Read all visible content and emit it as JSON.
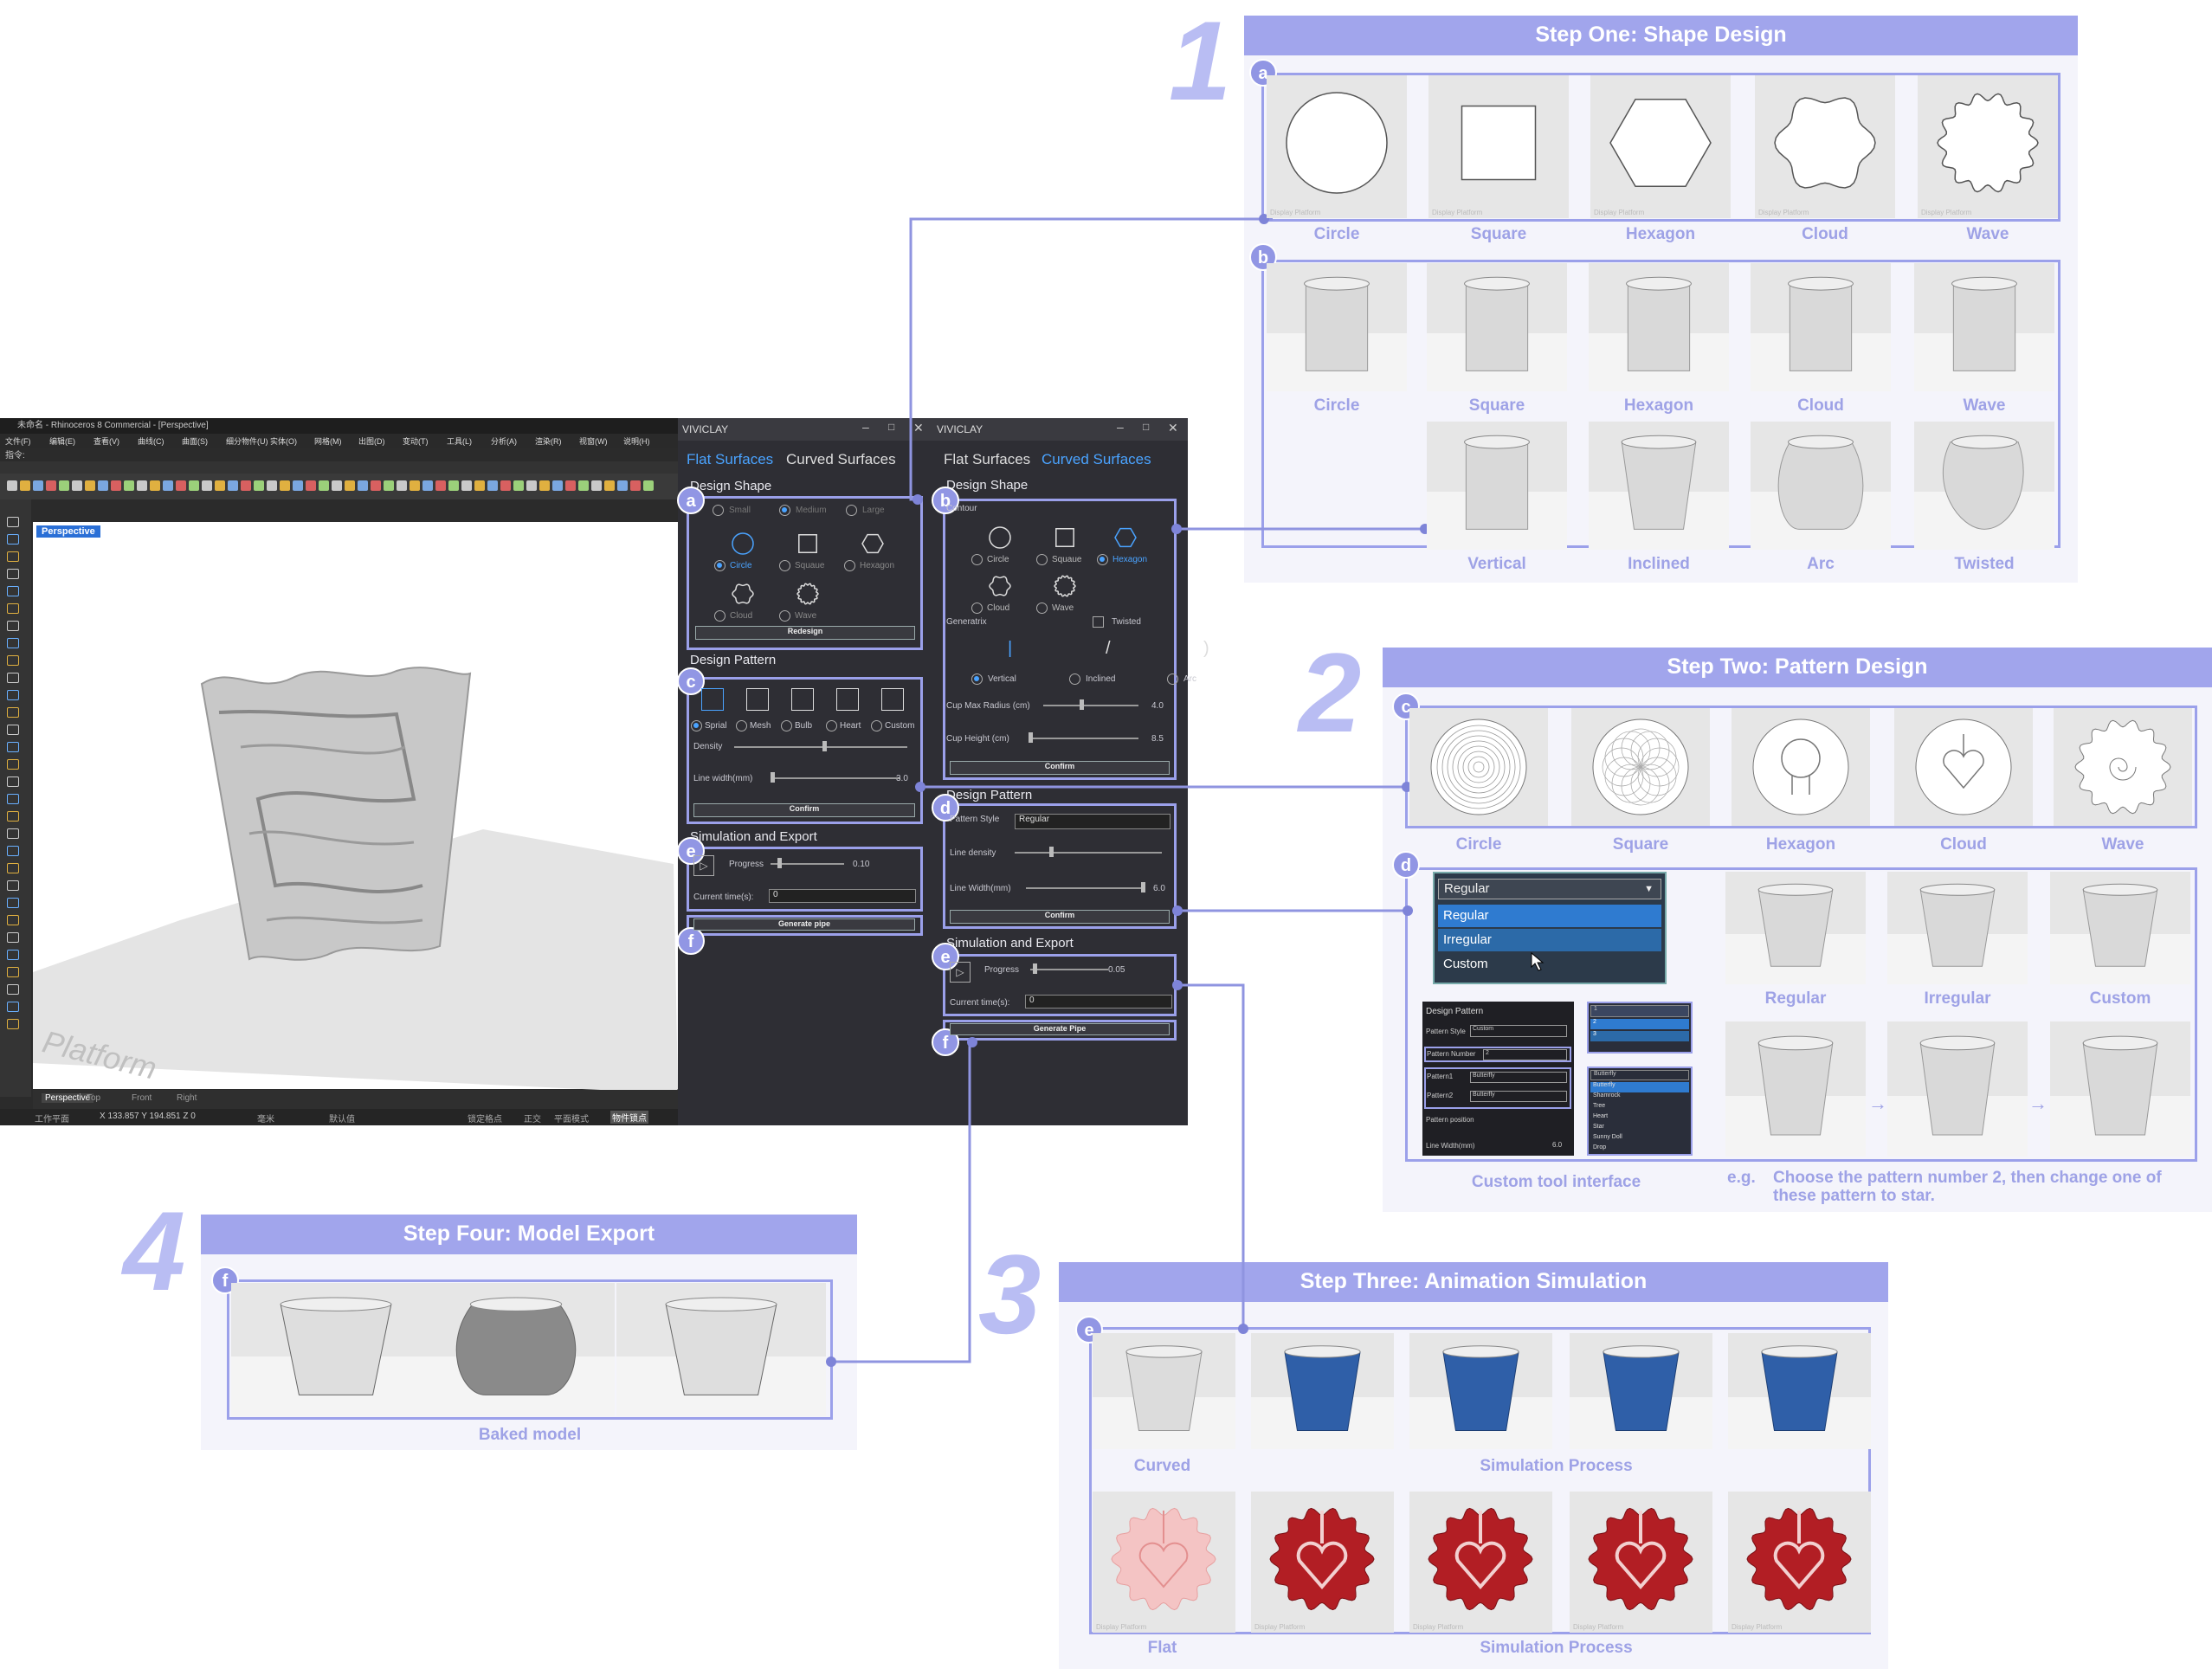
{
  "step1": {
    "number": "1",
    "title": "Step One: Shape Design",
    "row_a": [
      "Circle",
      "Square",
      "Hexagon",
      "Cloud",
      "Wave"
    ],
    "row_b": [
      "Circle",
      "Square",
      "Hexagon",
      "Cloud",
      "Wave"
    ],
    "row_b2": [
      "Vertical",
      "Inclined",
      "Arc",
      "Twisted"
    ],
    "display_platform": "Display Platform"
  },
  "step2": {
    "number": "2",
    "title": "Step Two: Pattern Design",
    "row_c": [
      "Circle",
      "Square",
      "Hexagon",
      "Cloud",
      "Wave"
    ],
    "dropdown": {
      "value": "Regular",
      "options": [
        "Regular",
        "Irregular",
        "Custom"
      ]
    },
    "row_d": [
      "Regular",
      "Irregular",
      "Custom"
    ],
    "custom_caption": "Custom tool interface",
    "eg_label": "e.g.",
    "eg_text": "Choose the pattern number 2, then change one of these pattern to star.",
    "mini": {
      "title": "Design Pattern",
      "style_label": "Pattern Style",
      "style_value": "Custom",
      "number_label": "Pattern Number",
      "number_value": "2",
      "p1_label": "Pattern1",
      "p1_value": "Butterfly",
      "p2_label": "Pattern2",
      "p2_value": "Butterfly",
      "pos_label": "Pattern position",
      "lw_label": "Line Width(mm)",
      "lw_value": "6.0",
      "num_options": [
        "1",
        "2",
        "3"
      ],
      "shape_options": [
        "Butterfly",
        "Shamrock",
        "Tree",
        "Heart",
        "Star",
        "Sunny Doll",
        "Drop"
      ]
    }
  },
  "step3": {
    "number": "3",
    "title": "Step Three: Animation Simulation",
    "caption_curved": "Curved",
    "caption_sim1": "Simulation Process",
    "caption_flat": "Flat",
    "caption_sim2": "Simulation Process"
  },
  "step4": {
    "number": "4",
    "title": "Step Four: Model Export",
    "caption": "Baked model"
  },
  "badges": {
    "a": "a",
    "b": "b",
    "c": "c",
    "d": "d",
    "e": "e",
    "f": "f"
  },
  "rhino": {
    "title": "未命名 - Rhinoceros 8 Commercial - [Perspective]",
    "menu": [
      "文件(F)",
      "编辑(E)",
      "查看(V)",
      "曲线(C)",
      "曲面(S)",
      "细分物件(U)",
      "实体(O)",
      "网格(M)",
      "出图(D)",
      "变动(T)",
      "工具(L)",
      "分析(A)",
      "渲染(R)",
      "视窗(W)",
      "说明(H)"
    ],
    "command": "指令:",
    "viewport_label": "Perspective",
    "platform_text": "Platform",
    "tabs": [
      "Perspective",
      "Top",
      "Front",
      "Right"
    ],
    "status": {
      "plane": "工作平面",
      "coords": "X 133.857  Y 194.851  Z 0",
      "unit": "毫米",
      "layer": "默认值",
      "snap": "锁定格点",
      "ortho": "正交",
      "planar": "平面模式",
      "osnap": "物件锁点"
    }
  },
  "panel_flat": {
    "app": "VIVICLAY",
    "tab_flat": "Flat Surfaces",
    "tab_curved": "Curved Surfaces",
    "design_shape": "Design Shape",
    "sizes": [
      "Small",
      "Medium",
      "Large"
    ],
    "shapes": [
      "Circle",
      "Squaue",
      "Hexagon",
      "Cloud",
      "Wave"
    ],
    "redesign": "Redesign",
    "design_pattern": "Design Pattern",
    "patterns": [
      "Sprial",
      "Mesh",
      "Bulb",
      "Heart",
      "Custom"
    ],
    "density": "Density",
    "line_width": "Line width(mm)",
    "line_width_value": "3.0",
    "confirm": "Confirm",
    "sim_export": "Simulation and Export",
    "progress": "Progress",
    "progress_value": "0.10",
    "current_time": "Current time(s):",
    "current_time_value": "0",
    "generate": "Generate pipe"
  },
  "panel_curved": {
    "app": "VIVICLAY",
    "tab_flat": "Flat Surfaces",
    "tab_curved": "Curved Surfaces",
    "design_shape": "Design Shape",
    "contour": "Contour",
    "shapes": [
      "Circle",
      "Squaue",
      "Hexagon",
      "Cloud",
      "Wave"
    ],
    "generatrix": "Generatrix",
    "twisted": "Twisted",
    "gen_types": [
      "Vertical",
      "Inclined",
      "Arc"
    ],
    "cup_max_radius": "Cup Max Radius (cm)",
    "cup_max_radius_value": "4.0",
    "cup_height": "Cup Height (cm)",
    "cup_height_value": "8.5",
    "confirm": "Confirm",
    "design_pattern": "Design Pattern",
    "pattern_style": "Pattern Style",
    "pattern_style_value": "Regular",
    "line_density": "Line density",
    "line_width": "Line Width(mm)",
    "line_width_value": "6.0",
    "sim_export": "Simulation and Export",
    "progress": "Progress",
    "progress_value": "0.05",
    "current_time": "Current time(s):",
    "current_time_value": "0",
    "generate": "Generate Pipe"
  },
  "colors": {
    "accent": "#a1a5ec",
    "frame": "#9ba0ea",
    "caption": "#9ea2e6",
    "sim_blue": "#2f5fa8",
    "sim_red": "#b21e24",
    "flat_pink": "#f4c4c4"
  }
}
